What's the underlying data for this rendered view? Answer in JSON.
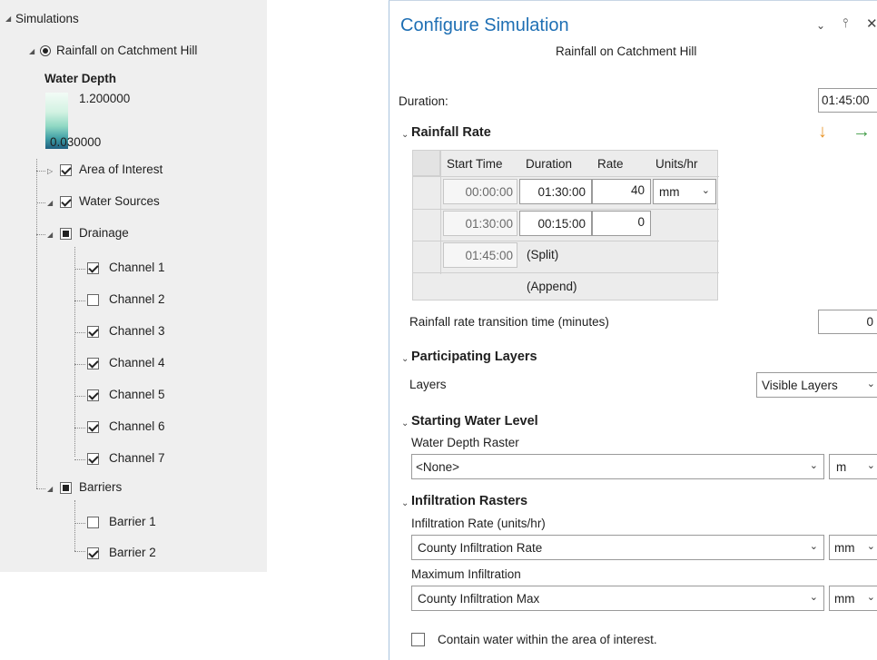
{
  "tree": {
    "root_label": "Simulations",
    "simulation_label": "Rainfall on Catchment Hill",
    "legend": {
      "title": "Water Depth",
      "max": "1.200000",
      "min": "0.030000"
    },
    "area_of_interest": "Area of Interest",
    "water_sources": "Water Sources",
    "drainage": "Drainage",
    "channels": [
      {
        "label": "Channel 1",
        "checked": true
      },
      {
        "label": "Channel 2",
        "checked": false
      },
      {
        "label": "Channel 3",
        "checked": true
      },
      {
        "label": "Channel 4",
        "checked": true
      },
      {
        "label": "Channel 5",
        "checked": true
      },
      {
        "label": "Channel 6",
        "checked": true
      },
      {
        "label": "Channel 7",
        "checked": true
      }
    ],
    "barriers": "Barriers",
    "barrier_items": [
      {
        "label": "Barrier 1",
        "checked": false
      },
      {
        "label": "Barrier 2",
        "checked": true
      }
    ]
  },
  "pane": {
    "title": "Configure Simulation",
    "subtitle": "Rainfall on Catchment Hill",
    "duration_label": "Duration:",
    "duration_value": "01:45:00",
    "rainfall_rate": {
      "heading": "Rainfall Rate",
      "headers": [
        "Start Time",
        "Duration",
        "Rate",
        "Units/hr"
      ],
      "rows": [
        {
          "start": "00:00:00",
          "duration": "01:30:00",
          "rate": "40",
          "units": "mm"
        },
        {
          "start": "01:30:00",
          "duration": "00:15:00",
          "rate": "0"
        }
      ],
      "split_start": "01:45:00",
      "split_label": "(Split)",
      "append_label": "(Append)",
      "transition_label": "Rainfall rate transition time (minutes)",
      "transition_value": "0"
    },
    "participating": {
      "heading": "Participating Layers",
      "label": "Layers",
      "value": "Visible Layers"
    },
    "starting_level": {
      "heading": "Starting Water Level",
      "raster_label": "Water Depth Raster",
      "raster_value": "<None>",
      "unit": "m"
    },
    "infiltration": {
      "heading": "Infiltration Rasters",
      "rate_label": "Infiltration Rate (units/hr)",
      "rate_value": "County Infiltration Rate",
      "rate_unit": "mm",
      "max_label": "Maximum Infiltration",
      "max_value": "County Infiltration Max",
      "max_unit": "mm"
    },
    "contain_label": "Contain water within the area of interest.",
    "contain_checked": false
  },
  "colors": {
    "title_blue": "#1e6fb4",
    "arrow_orange": "#e8952b",
    "arrow_green": "#3f9b45",
    "tree_bg": "#efefef"
  }
}
